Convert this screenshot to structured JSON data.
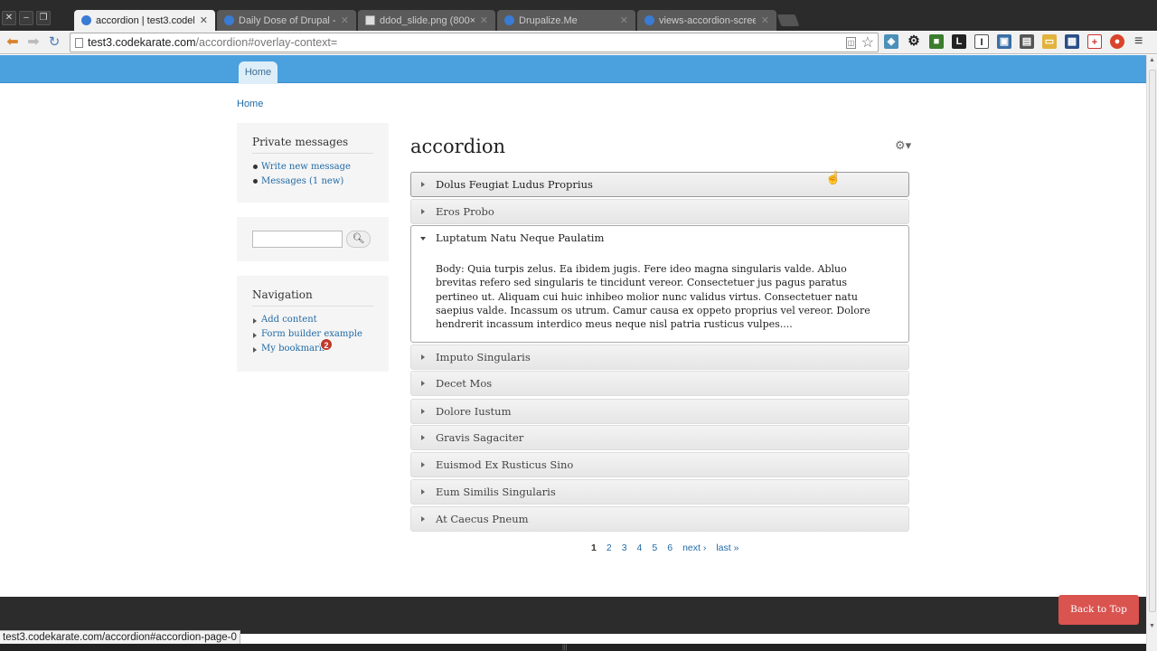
{
  "browser": {
    "tabs": [
      {
        "title": "accordion | test3.codekarate",
        "active": true
      },
      {
        "title": "Daily Dose of Drupal - D",
        "active": false
      },
      {
        "title": "ddod_slide.png (800×50",
        "active": false
      },
      {
        "title": "Drupalize.Me",
        "active": false
      },
      {
        "title": "views-accordion-screen",
        "active": false
      }
    ],
    "url_host": "test3.codekarate.com",
    "url_path": "/accordion#overlay-context=",
    "status_url": "test3.codekarate.com/accordion#accordion-page-0"
  },
  "site": {
    "nav_home": "Home",
    "breadcrumb": "Home",
    "accent_color": "#4ba1de"
  },
  "sidebar": {
    "private_messages": {
      "title": "Private messages",
      "links": [
        "Write new message",
        "Messages (1 new)"
      ]
    },
    "search": {
      "button_icon": "search-icon"
    },
    "navigation": {
      "title": "Navigation",
      "links": [
        "Add content",
        "Form builder example",
        "My bookmarks"
      ],
      "badge": "2"
    }
  },
  "main": {
    "title": "accordion",
    "accordion": [
      {
        "label": "Dolus Feugiat Ludus Proprius"
      },
      {
        "label": "Eros Probo"
      },
      {
        "label": "Luptatum Natu Neque Paulatim",
        "open": true,
        "body": "Body: Quia turpis zelus. Ea ibidem jugis. Fere ideo magna singularis valde. Abluo brevitas refero sed singularis te tincidunt vereor. Consectetuer jus pagus paratus pertineo ut. Aliquam cui huic inhibeo molior nunc validus virtus. Consectetuer natu saepius valde. Incassum os utrum. Camur causa ex oppeto proprius vel vereor. Dolore hendrerit incassum interdico meus neque nisl patria rusticus vulpes...."
      },
      {
        "label": "Imputo Singularis"
      },
      {
        "label": "Decet Mos"
      },
      {
        "label": "Dolore Iustum"
      },
      {
        "label": "Gravis Sagaciter"
      },
      {
        "label": "Euismod Ex Rusticus Sino"
      },
      {
        "label": "Eum Similis Singularis"
      },
      {
        "label": "At Caecus Pneum"
      }
    ],
    "pager": [
      "1",
      "2",
      "3",
      "4",
      "5",
      "6",
      "next ›",
      "last »"
    ]
  },
  "footer": {
    "back_to_top": "Back to Top"
  }
}
